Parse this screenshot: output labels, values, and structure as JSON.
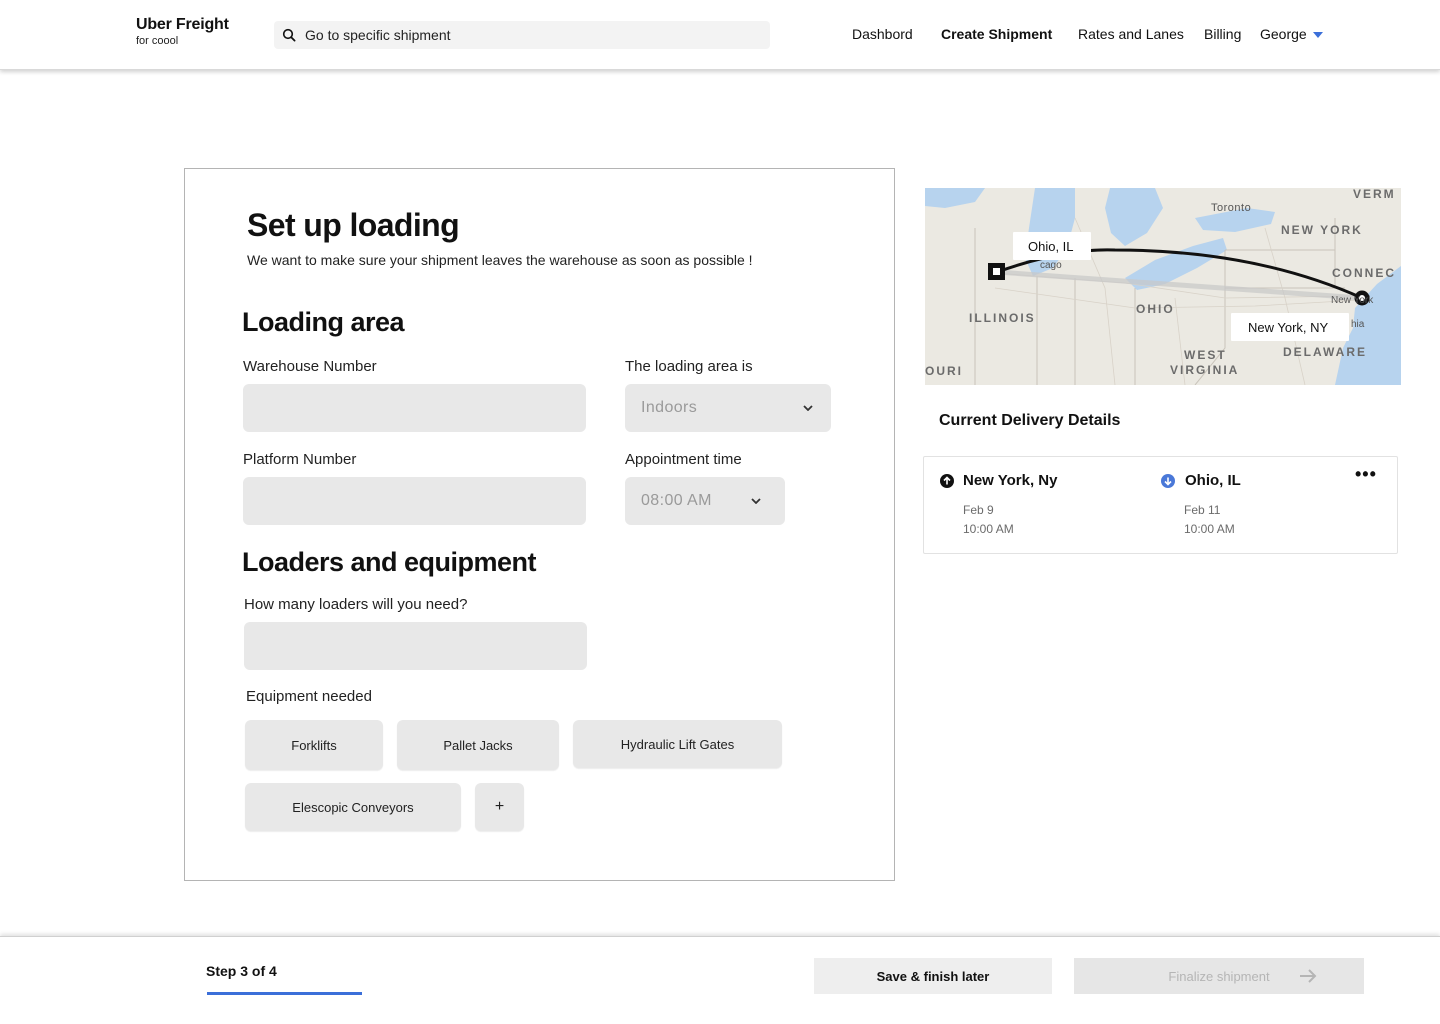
{
  "header": {
    "brand": "Uber Freight",
    "brand_sub": "for coool",
    "search_placeholder": "Go to specific shipment",
    "nav": [
      "Dashbord",
      "Create Shipment",
      "Rates and Lanes",
      "Billing"
    ],
    "active_nav": "Create Shipment",
    "user": "George",
    "accent_color": "#3b6fd9"
  },
  "form": {
    "title": "Set up loading",
    "subtitle": "We want to make sure your shipment leaves the warehouse as soon as possible !",
    "loading_area": {
      "heading": "Loading area",
      "warehouse_label": "Warehouse Number",
      "warehouse_value": "",
      "platform_label": "Platform Number",
      "platform_value": "",
      "area_label": "The loading area is",
      "area_value": "Indoors",
      "time_label": "Appointment time",
      "time_value": "08:00 AM"
    },
    "loaders": {
      "heading": "Loaders and equipment",
      "count_label": "How many loaders will you need?",
      "count_value": "",
      "equipment_label": "Equipment needed",
      "equipment": [
        "Forklifts",
        "Pallet Jacks",
        "Hydraulic Lift Gates",
        "Elescopic Conveyors"
      ],
      "add_label": "+"
    }
  },
  "map": {
    "origin_callout": "Ohio, IL",
    "destination_callout": "New York, NY",
    "labels": [
      "Toronto",
      "NEW YORK",
      "VERM",
      "CONNEC",
      "ILLINOIS",
      "OHIO",
      "WEST",
      "VIRGINIA",
      "DELAWARE",
      "OURI",
      "New York",
      "hia",
      "cago"
    ]
  },
  "delivery": {
    "title": "Current Delivery Details",
    "more": "•••",
    "from": {
      "city": "New York, Ny",
      "date": "Feb 9",
      "time": "10:00 AM"
    },
    "to": {
      "city": "Ohio, IL",
      "date": "Feb 11",
      "time": "10:00 AM"
    }
  },
  "footer": {
    "step": "Step 3 of 4",
    "progress": 0.75,
    "save_label": "Save & finish later",
    "finalize_label": "Finalize shipment"
  }
}
